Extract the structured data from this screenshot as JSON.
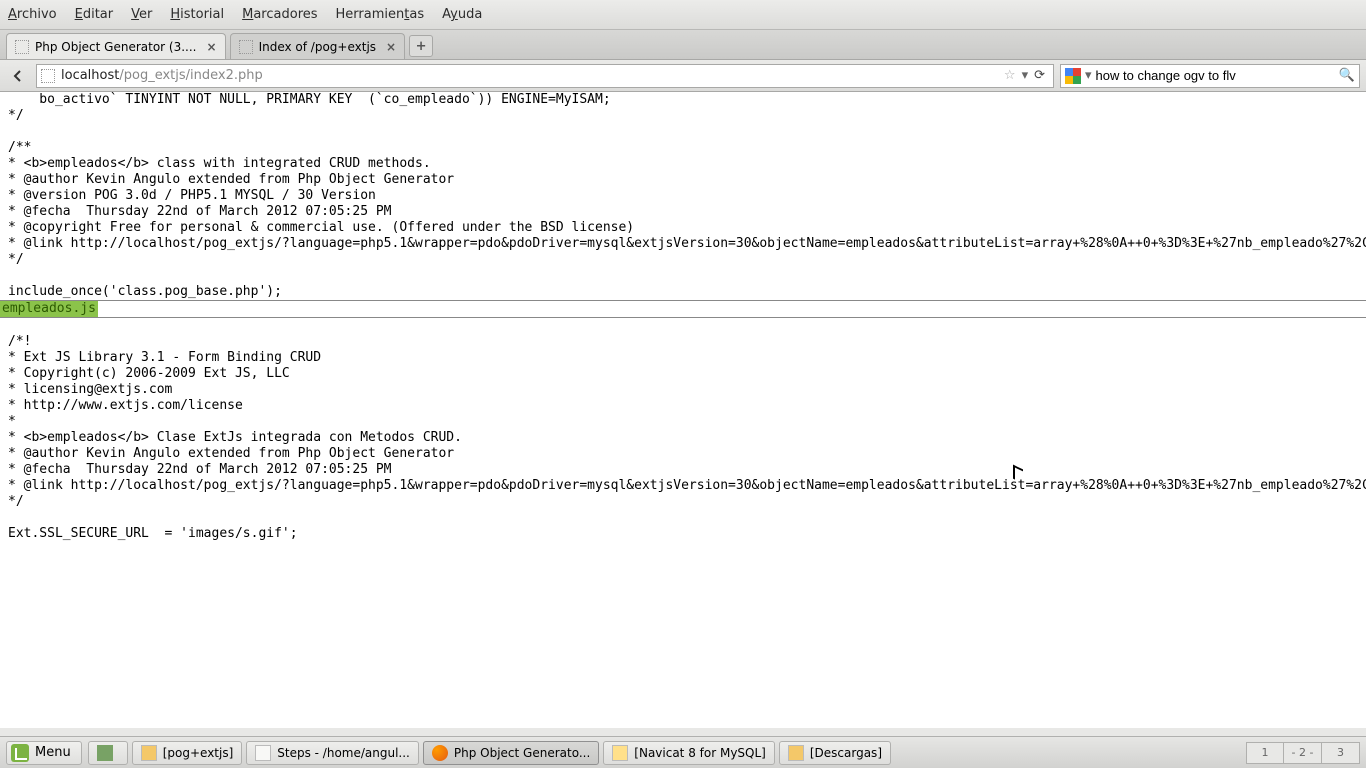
{
  "menubar": [
    "Archivo",
    "Editar",
    "Ver",
    "Historial",
    "Marcadores",
    "Herramientas",
    "Ayuda"
  ],
  "menubar_accel": [
    0,
    0,
    0,
    0,
    0,
    9,
    1
  ],
  "tabs": [
    {
      "label": "Php Object Generator (3....",
      "active": true
    },
    {
      "label": "Index of /pog+extjs",
      "active": false
    }
  ],
  "url_host": "localhost",
  "url_path": "/pog_extjs/index2.php",
  "search_value": "how to change ogv to flv",
  "code_top": "    bo_activo` TINYINT NOT NULL, PRIMARY KEY  (`co_empleado`)) ENGINE=MyISAM;\n*/\n\n/**\n* <b>empleados</b> class with integrated CRUD methods.\n* @author Kevin Angulo extended from Php Object Generator\n* @version POG 3.0d / PHP5.1 MYSQL / 30 Version\n* @fecha  Thursday 22nd of March 2012 07:05:25 PM\n* @copyright Free for personal & commercial use. (Offered under the BSD license)\n* @link http://localhost/pog_extjs/?language=php5.1&wrapper=pdo&pdoDriver=mysql&extjsVersion=30&objectName=empleados&attributeList=array+%28%0A++0+%3D%3E+%27nb_empleado%27%2C%0A++1+%27%2C%0A++2+%3D%3E+%27tx_email%27%2C%0A++3+%3D%3E+%27tx_direccion%27%2C%0A++4+%3D%3E+%27fe_ingreso%27%2C%0A++5+%3D%3E+%27mo_sueldo%27%2C%0A++6+%3D%3E+%27bo_activo%27%2C%0A+%29&typeL%2B%2528%250A%2B%2B0%2B%253D%253E%2B%2527VARCHAR%2528255%2529%2527%252C%250A%2B%2B1%2B%253D%253E%2B%2527VARCHAR%2528255%2529%2527%252C%250A%2B%2B2%2B%253D%253E%2B%2527VARCHAR%2528255%2529%2527%252C%250A%2B%2B3%2B%253D%253E%2B%2527VARCHAR%2528255%2529%2527%252C%250A%2B%2B4%2B%253D%253E%2B%2527DATE%2527%252C%250A%2B%2B5%2B%253D%253E%2B%2527FLOAT%2527%252C%250A%2B%2B6%2B%253D%253E%2B%2527TINYINT%2527%252C%250A%2529&renderList=array+%28%0A++0+%3D%3E+%27Ext.form.TextField%27%2C%0A++1+%3D%3E+%27Ext.form.ComboBox%2%3D%3E+%27Ext.form.TextField%27%2C%0A++3+%3D%3E+%27Ext.form.TextArea%27%2C%0A++4+%3D%3E+%27Ext.form.DateField%27%2C%0A++5+%3D%3E+%27Ext.form.TextField%27%2C%0A++6+%3D%3E+%27Ext.form%0A%29\n*/\n\ninclude_once('class.pog_base.php');",
  "file_label": "empleados.js",
  "code_bottom": "/*!\n* Ext JS Library 3.1 - Form Binding CRUD\n* Copyright(c) 2006-2009 Ext JS, LLC\n* licensing@extjs.com\n* http://www.extjs.com/license\n*\n* <b>empleados</b> Clase ExtJs integrada con Metodos CRUD.\n* @author Kevin Angulo extended from Php Object Generator\n* @fecha  Thursday 22nd of March 2012 07:05:25 PM\n* @link http://localhost/pog_extjs/?language=php5.1&wrapper=pdo&pdoDriver=mysql&extjsVersion=30&objectName=empleados&attributeList=array+%28%0A++0+%3D%3E+%27nb_empleado%27%2C%0A++1+%27%2C%0A++2+%3D%3E+%27tx_email%27%2C%0A++3+%3D%3E+%27tx_direccion%27%2C%0A++4+%3D%3E+%27fe_ingreso%27%2C%0A++5+%3D%3E+%27mo_sueldo%27%2C%0A++6+%3D%3E+%27bo_activo%27%2C%0A+%29&typeL%2B%2528%250A%2B%2B0%2B%253D%253E%2B%2527VARCHAR%2528255%2529%2527%252C%250A%2B%2B1%2B%253D%253E%2B%2527VARCHAR%2528255%2529%2527%252C%250A%2B%2B2%2B%253D%253E%2B%2527VARCHAR%2528255%2529%2527%252C%250A%2B%2B3%2B%253D%253E%2B%2527VARCHAR%2528255%2529%2527%252C%250A%2B%2B4%2B%253D%253E%2B%2527DATE%2527%252C%250A%2B%2B5%2B%253D%253E%2B%2527FLOAT%2527%252C%250A%2B%2B6%2B%253D%253E%2B%2527TINYINT%2527%252C%250A%2529&renderList=array%2B%2528%250A%2B%2B0%2B%253D%253E%2B%2527Ext.form.TextField%2527%252C%250A%2B%2B1%2B%2527Ext.form.ComboBox%2527%252C%250A%2B%2B2%2B%253D%253E%2B%2527Ext.form.TextField%2527%252C%250A%2B%2B3%2B%253D%253E%2B%2527Ext.form.TextArea%2527%252C%250A%2B%2B4%2B%253D%253E%2B%2527Ext.form.DateField%2527%252C%250A%2B%2B5%2B%253D%253E%2B%2527Ext.form.TextField%2527%252C%250A%2B%2B6%2B%253D%253E%2B%2527Ext.form.Checkbox%2527%252C%250A%2529\n*/\n\nExt.SSL_SECURE_URL  = 'images/s.gif';",
  "taskbar": {
    "menu_label": "Menu",
    "items": [
      {
        "label": "[pog+extjs]",
        "icon": "folder"
      },
      {
        "label": "Steps - /home/angul...",
        "icon": "doc"
      },
      {
        "label": "Php Object Generato...",
        "icon": "ff",
        "active": true
      },
      {
        "label": "[Navicat 8 for MySQL]",
        "icon": "db"
      },
      {
        "label": "[Descargas]",
        "icon": "folder"
      }
    ],
    "pager": [
      "1",
      "- 2 -",
      "3"
    ]
  }
}
